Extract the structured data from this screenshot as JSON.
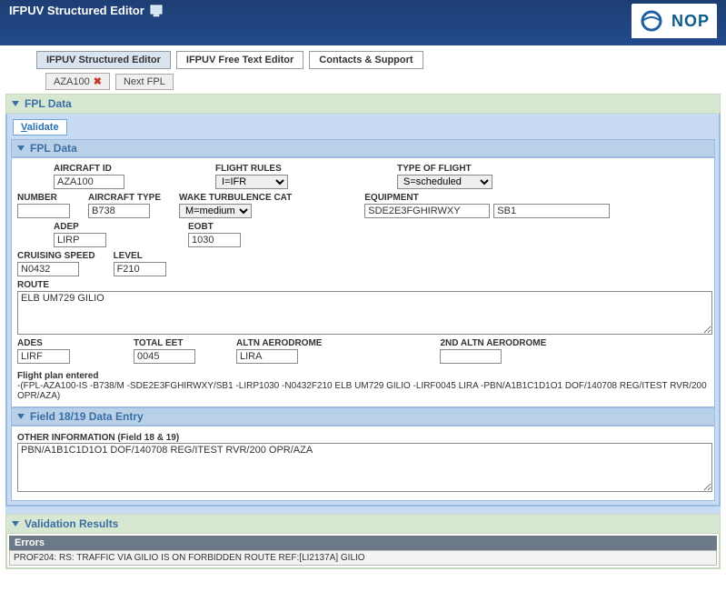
{
  "header": {
    "title": "IFPUV Structured Editor",
    "brand": "NOP"
  },
  "tabs": {
    "main": [
      {
        "label": "IFPUV Structured Editor",
        "active": true
      },
      {
        "label": "IFPUV Free Text Editor",
        "active": false
      },
      {
        "label": "Contacts & Support",
        "active": false
      }
    ],
    "sub": [
      {
        "label": "AZA100",
        "closable": true
      },
      {
        "label": "Next FPL",
        "closable": false
      }
    ]
  },
  "fpl": {
    "section_title": "FPL Data",
    "validate_label": "Validate",
    "subsection_title": "FPL Data",
    "labels": {
      "aircraft_id": "AIRCRAFT ID",
      "flight_rules": "FLIGHT RULES",
      "type_of_flight": "TYPE OF FLIGHT",
      "number": "NUMBER",
      "aircraft_type": "AIRCRAFT TYPE",
      "wake": "WAKE TURBULENCE CAT",
      "equipment": "EQUIPMENT",
      "adep": "ADEP",
      "eobt": "EOBT",
      "cruise": "CRUISING SPEED",
      "level": "LEVEL",
      "route": "ROUTE",
      "ades": "ADES",
      "total_eet": "TOTAL EET",
      "altn": "ALTN AERODROME",
      "altn2": "2ND ALTN AERODROME"
    },
    "values": {
      "aircraft_id": "AZA100",
      "flight_rules": "I=IFR",
      "type_of_flight": "S=scheduled",
      "number": "",
      "aircraft_type": "B738",
      "wake": "M=medium",
      "equipment_a": "SDE2E3FGHIRWXY",
      "equipment_b": "SB1",
      "adep": "LIRP",
      "eobt": "1030",
      "cruise": "N0432",
      "level": "F210",
      "route": "ELB UM729 GILIO",
      "ades": "LIRF",
      "total_eet": "0045",
      "altn": "LIRA",
      "altn2": ""
    },
    "entered_label": "Flight plan entered",
    "entered_text": "-(FPL-AZA100-IS -B738/M -SDE2E3FGHIRWXY/SB1 -LIRP1030 -N0432F210 ELB UM729 GILIO -LIRF0045 LIRA -PBN/A1B1C1D1O1 DOF/140708 REG/ITEST RVR/200 OPR/AZA)"
  },
  "field18": {
    "section_title": "Field 18/19 Data Entry",
    "label": "OTHER INFORMATION (Field 18 & 19)",
    "value": "PBN/A1B1C1D1O1 DOF/140708 REG/ITEST RVR/200 OPR/AZA"
  },
  "validation": {
    "section_title": "Validation Results",
    "errors_label": "Errors",
    "errors": [
      "PROF204: RS: TRAFFIC VIA GILIO IS ON FORBIDDEN ROUTE REF:[LI2137A] GILIO"
    ]
  }
}
